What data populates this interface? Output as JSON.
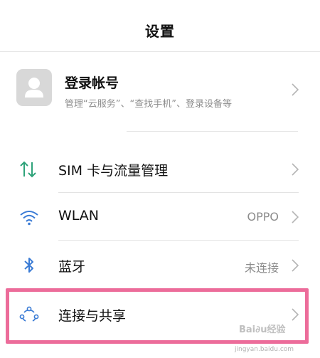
{
  "header": {
    "title": "设置"
  },
  "account": {
    "title": "登录帐号",
    "subtitle": "管理“云服务”、“查找手机”、登录设备等"
  },
  "settings": {
    "items": [
      {
        "label": "SIM 卡与流量管理",
        "value": "",
        "icon": "sim-data-icon"
      },
      {
        "label": "WLAN",
        "value": "OPPO",
        "icon": "wifi-icon"
      },
      {
        "label": "蓝牙",
        "value": "未连接",
        "icon": "bluetooth-icon"
      },
      {
        "label": "连接与共享",
        "value": "",
        "icon": "connection-share-icon"
      }
    ]
  },
  "watermark": {
    "text": "Bai∂u经验",
    "url": "jingyan.baidu.com"
  },
  "colors": {
    "icon_green": "#2fa37a",
    "icon_blue": "#3a7bd5",
    "highlight": "#ec6c9a",
    "muted_text": "#8c8c8c"
  }
}
